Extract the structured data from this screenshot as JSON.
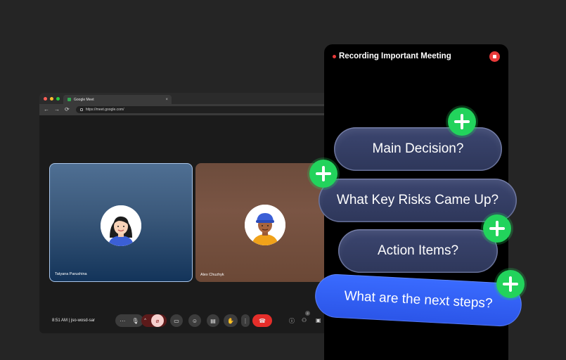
{
  "browser": {
    "tab_title": "Google Meet",
    "url": "https://meet.google.com/",
    "nav": {
      "back": "←",
      "forward": "→",
      "reload": "⟳",
      "close_tab": "×"
    }
  },
  "meeting": {
    "participants": [
      {
        "name": "Tatyana Parushina"
      },
      {
        "name": "Alex Chuzhyk"
      }
    ],
    "time": "8:51 AM",
    "code": "jso-wosd-sar",
    "participant_count": "2",
    "controls": {
      "more": "···",
      "mic": "🎙",
      "chevron": "^",
      "camera_off": "⌀",
      "present": "▭",
      "emoji": "☺",
      "captions": "▤",
      "raise_hand": "✋",
      "options": "⋮",
      "end_call": "☎"
    }
  },
  "recorder": {
    "title": "Recording Important Meeting",
    "questions": [
      "Main Decision?",
      "What Key Risks Came Up?",
      "Action Items?",
      "What are the next steps?"
    ]
  },
  "colors": {
    "accent_green": "#22d35c",
    "accent_blue": "#3a6bff",
    "record_red": "#e83a3a"
  }
}
